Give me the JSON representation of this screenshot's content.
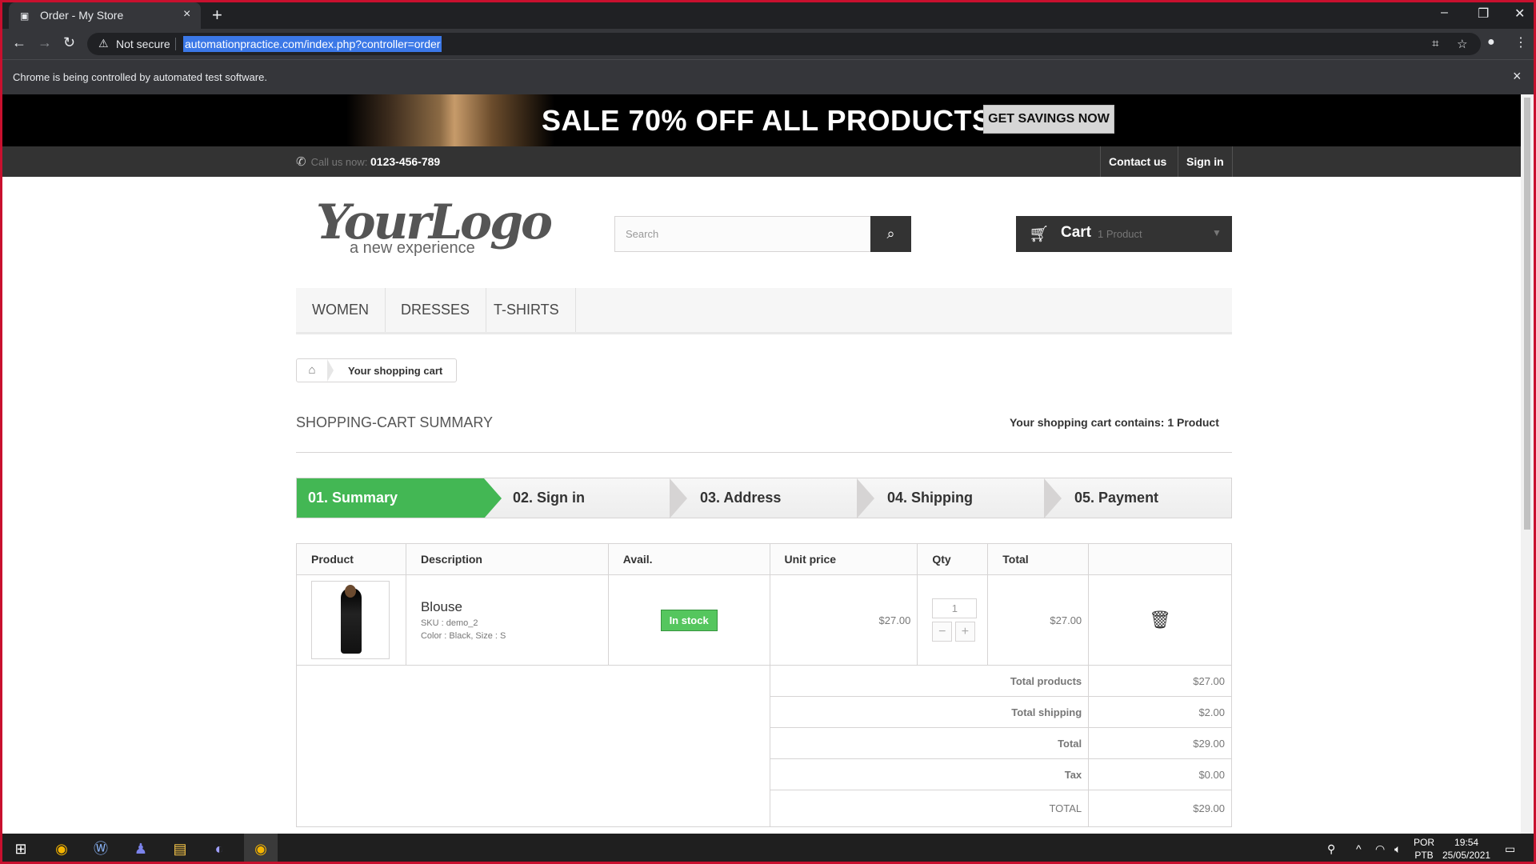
{
  "browser": {
    "tab_title": "Order - My Store",
    "new_tab": "+",
    "security": "Not secure",
    "url": "automationpractice.com/index.php?controller=order",
    "infobar": "Chrome is being controlled by automated test software."
  },
  "banner": {
    "headline": "SALE 70% OFF ALL PRODUCTS",
    "button": "GET SAVINGS NOW"
  },
  "topnav": {
    "call_label": "Call us now:",
    "phone": "0123-456-789",
    "contact": "Contact us",
    "signin": "Sign in"
  },
  "header": {
    "logo_script": "YourLogo",
    "logo_tag": "a new experience",
    "search_placeholder": "Search",
    "cart_label": "Cart",
    "cart_count": "1 Product"
  },
  "menu": [
    "WOMEN",
    "DRESSES",
    "T-SHIRTS"
  ],
  "breadcrumb": "Your shopping cart",
  "summary": {
    "heading": "SHOPPING-CART SUMMARY",
    "contains_label": "Your shopping cart contains:",
    "contains_value": "1 Product"
  },
  "steps": [
    "01. Summary",
    "02. Sign in",
    "03. Address",
    "04. Shipping",
    "05. Payment"
  ],
  "table": {
    "headers": [
      "Product",
      "Description",
      "Avail.",
      "Unit price",
      "Qty",
      "Total"
    ],
    "item": {
      "name": "Blouse",
      "sku": "SKU : demo_2",
      "attrs": "Color : Black, Size : S",
      "availability": "In stock",
      "unit_price": "$27.00",
      "qty": "1",
      "total": "$27.00"
    },
    "totals": [
      {
        "label": "Total products",
        "value": "$27.00"
      },
      {
        "label": "Total shipping",
        "value": "$2.00"
      },
      {
        "label": "Total",
        "value": "$29.00"
      },
      {
        "label": "Tax",
        "value": "$0.00"
      }
    ],
    "grand_label": "TOTAL",
    "grand_value": "$29.00"
  },
  "taskbar": {
    "lang1": "POR",
    "lang2": "PTB",
    "time": "19:54",
    "date": "25/05/2021"
  },
  "colors": {
    "active_step": "#43b754",
    "in_stock": "#55c65e",
    "window_border": "#c8102e"
  }
}
